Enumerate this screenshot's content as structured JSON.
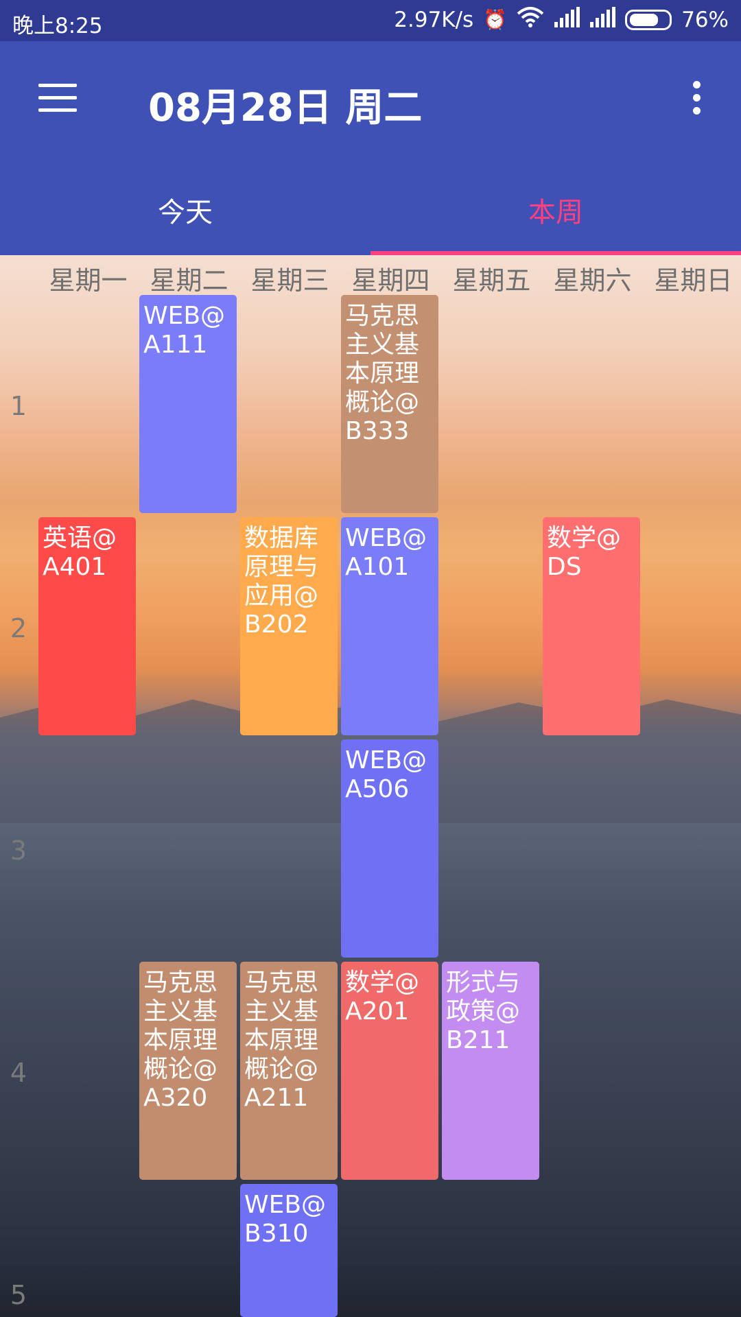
{
  "status_bar": {
    "time": "晚上8:25",
    "speed": "2.97K/s",
    "alarm_icon": "alarm-icon",
    "wifi_icon": "wifi-icon",
    "signal_icon": "signal-icon",
    "battery_percent": "76%",
    "battery_level": 0.76
  },
  "app_bar": {
    "title": "08月28日 周二",
    "menu_icon": "menu-icon",
    "more_icon": "more-vert-icon"
  },
  "tabs": [
    {
      "label": "今天",
      "selected": false
    },
    {
      "label": "本周",
      "selected": true
    }
  ],
  "colors": {
    "primary": "#3f51b5",
    "status": "#2f3a93",
    "accent": "#ff4081"
  },
  "weekdays": [
    "星期一",
    "星期二",
    "星期三",
    "星期四",
    "星期五",
    "星期六",
    "星期日"
  ],
  "rows": [
    "1",
    "2",
    "3",
    "4",
    "5"
  ],
  "courses": [
    {
      "text": "WEB@A111",
      "day": 2,
      "start": 1,
      "span": 1,
      "color": "#7b7cf7"
    },
    {
      "text": "马克思主义基本原理概论@B333",
      "day": 4,
      "start": 1,
      "span": 1,
      "color": "#c49072"
    },
    {
      "text": "英语@A401",
      "day": 1,
      "start": 2,
      "span": 1,
      "color": "#ff4a4a"
    },
    {
      "text": "数据库原理与应用@B202",
      "day": 3,
      "start": 2,
      "span": 1,
      "color": "#ffab4d"
    },
    {
      "text": "WEB@A101",
      "day": 4,
      "start": 2,
      "span": 1,
      "color": "#7b7cf7"
    },
    {
      "text": "数学@DS",
      "day": 6,
      "start": 2,
      "span": 1,
      "color": "#ff6f6f"
    },
    {
      "text": "WEB@A506",
      "day": 4,
      "start": 3,
      "span": 1,
      "color": "#6f70f3"
    },
    {
      "text": "马克思主义基本原理概论@A320",
      "day": 2,
      "start": 4,
      "span": 1,
      "color": "#c28c6e"
    },
    {
      "text": "马克思主义基本原理概论@A211",
      "day": 3,
      "start": 4,
      "span": 1,
      "color": "#c28c6e"
    },
    {
      "text": "数学@A201",
      "day": 4,
      "start": 4,
      "span": 1,
      "color": "#f06a6a"
    },
    {
      "text": "形式与政策@B211",
      "day": 5,
      "start": 4,
      "span": 1,
      "color": "#c38cf0"
    },
    {
      "text": "WEB@B310",
      "day": 3,
      "start": 5,
      "span": 1,
      "color": "#6f70f3"
    }
  ]
}
